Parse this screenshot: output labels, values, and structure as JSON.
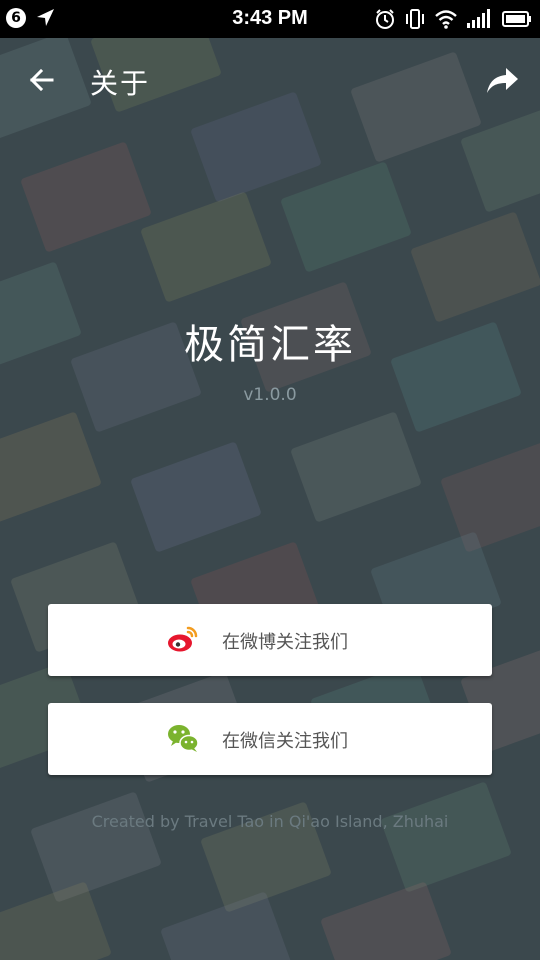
{
  "status_bar": {
    "notification_count": "6",
    "time": "3:43 PM",
    "icons": [
      "location-arrow-icon",
      "alarm-icon",
      "vibrate-icon",
      "wifi-icon",
      "signal-icon",
      "battery-icon"
    ]
  },
  "toolbar": {
    "title": "关于",
    "back_icon": "back-arrow-icon",
    "share_icon": "share-icon"
  },
  "app": {
    "name": "极简汇率",
    "version": "v1.0.0"
  },
  "buttons": {
    "weibo_label": "在微博关注我们",
    "wechat_label": "在微信关注我们"
  },
  "footer": {
    "credit": "Created by Travel Tao in Qi'ao Island, Zhuhai"
  },
  "colors": {
    "background": "#3b484d",
    "weibo": "#e6162d",
    "wechat": "#7bb32e"
  }
}
